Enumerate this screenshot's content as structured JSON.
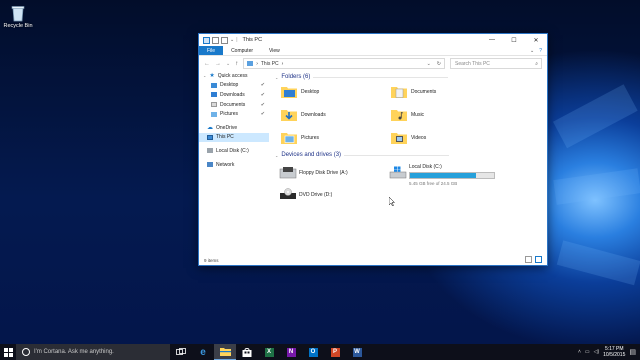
{
  "desktop": {
    "recycle_bin_label": "Recycle Bin"
  },
  "window": {
    "title": "This PC",
    "controls": {
      "minimize": "—",
      "maximize": "☐",
      "close": "✕"
    },
    "ribbon_tabs": [
      "File",
      "Computer",
      "View"
    ],
    "ribbon_right": {
      "expand": "⌄",
      "help": "?"
    },
    "address": {
      "back": "←",
      "forward": "→",
      "history": "⌄",
      "up": "↑",
      "path": "This PC",
      "separator": "›",
      "dropdown": "⌄",
      "refresh": "↻"
    },
    "search": {
      "placeholder": "Search This PC",
      "icon": "⌕"
    },
    "nav": {
      "quick_access": "Quick access",
      "items": [
        {
          "label": "Desktop",
          "pin": "✔"
        },
        {
          "label": "Downloads",
          "pin": "✔"
        },
        {
          "label": "Documents",
          "pin": "✔"
        },
        {
          "label": "Pictures",
          "pin": "✔"
        }
      ],
      "onedrive": "OneDrive",
      "this_pc": "This PC",
      "local_disk": "Local Disk (C:)",
      "network": "Network"
    },
    "folders_header": "Folders (6)",
    "folders": [
      "Desktop",
      "Documents",
      "Downloads",
      "Music",
      "Pictures",
      "Videos"
    ],
    "devices_header": "Devices and drives (3)",
    "devices": {
      "floppy": "Floppy Disk Drive (A:)",
      "local_disk": "Local Disk (C:)",
      "local_disk_space": "5.45 GB free of 24.5 GB",
      "local_disk_used_fraction": 0.78,
      "dvd": "DVD Drive (D:)"
    },
    "status": "9 items"
  },
  "taskbar": {
    "cortana_placeholder": "I'm Cortana. Ask me anything.",
    "apps": [
      "task-view",
      "edge",
      "file-explorer",
      "store",
      "excel",
      "onenote",
      "outlook",
      "powerpoint",
      "word"
    ],
    "app_letters": {
      "excel": "X",
      "onenote": "N",
      "outlook": "O",
      "powerpoint": "P",
      "word": "W"
    },
    "colors": {
      "excel": "#1e7145",
      "onenote": "#7719aa",
      "outlook": "#0072c6",
      "powerpoint": "#d24726",
      "word": "#2b579a",
      "accent": "#1979ca"
    },
    "time": "5:17 PM",
    "date": "10/5/2015"
  }
}
